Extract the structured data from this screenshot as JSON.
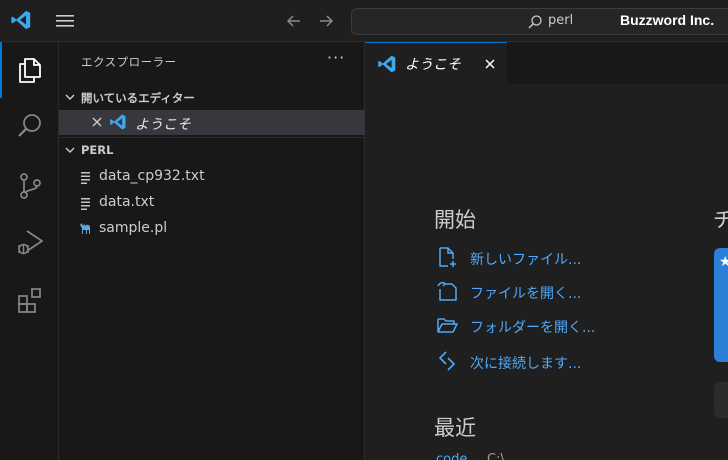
{
  "titlebar": {
    "search_text": "perl",
    "brand": "Buzzword Inc."
  },
  "activity_bar": {
    "items": [
      {
        "icon": "explorer-icon",
        "active": true
      },
      {
        "icon": "search-icon",
        "active": false
      },
      {
        "icon": "source-control-icon",
        "active": false
      },
      {
        "icon": "run-debug-icon",
        "active": false
      },
      {
        "icon": "extensions-icon",
        "active": false
      }
    ]
  },
  "sidebar": {
    "title": "エクスプローラー",
    "more": "···",
    "open_editors": {
      "header": "開いているエディター",
      "items": [
        {
          "label": "ようこそ"
        }
      ]
    },
    "folder": {
      "header": "PERL",
      "files": [
        {
          "name": "data_cp932.txt",
          "icon": "text-file-icon"
        },
        {
          "name": "data.txt",
          "icon": "text-file-icon"
        },
        {
          "name": "sample.pl",
          "icon": "perl-camel-icon"
        }
      ]
    }
  },
  "tabs": [
    {
      "label": "ようこそ",
      "active": true
    }
  ],
  "welcome": {
    "start_heading": "開始",
    "start_links": [
      {
        "label": "新しいファイル...",
        "icon": "new-file-icon"
      },
      {
        "label": "ファイルを開く...",
        "icon": "open-file-icon"
      },
      {
        "label": "フォルダーを開く...",
        "icon": "open-folder-icon"
      },
      {
        "label": "次に接続します...",
        "icon": "remote-connect-icon"
      }
    ],
    "recent_heading": "最近",
    "recent_items": [
      {
        "name": "code",
        "path": "C:\\"
      }
    ],
    "side_heading": "チ",
    "card_star": "★"
  },
  "colors": {
    "accent": "#0078d4",
    "link": "#4daafc",
    "vscode_blue": "#3fa7ec"
  }
}
